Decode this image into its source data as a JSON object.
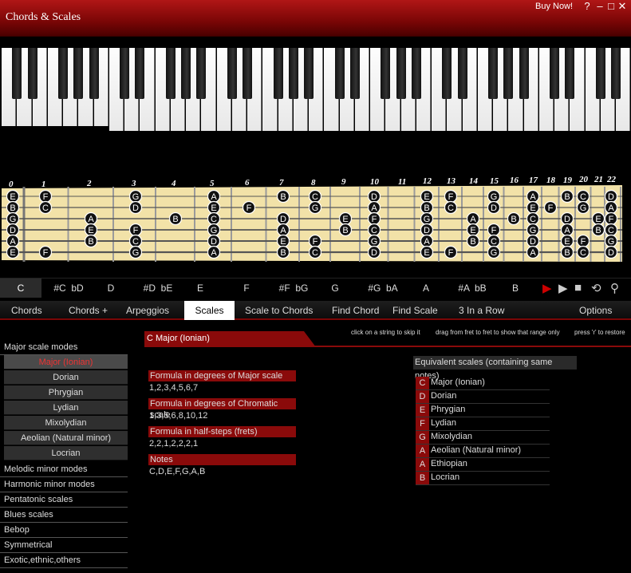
{
  "window": {
    "title": "Chords & Scales",
    "buy_now": "Buy Now!",
    "help": "?",
    "minimize": "–",
    "maximize": "□",
    "close": "✕"
  },
  "fret_numbers": [
    "0",
    "1",
    "2",
    "3",
    "4",
    "5",
    "6",
    "7",
    "8",
    "9",
    "10",
    "11",
    "12",
    "13",
    "14",
    "15",
    "16",
    "17",
    "18",
    "19",
    "20",
    "21",
    "22"
  ],
  "fretboard_strings": [
    "E",
    "B",
    "G",
    "D",
    "A",
    "E"
  ],
  "fretboard_notes": [
    {
      "string": 0,
      "fret": 0,
      "note": "E"
    },
    {
      "string": 0,
      "fret": 1,
      "note": "F"
    },
    {
      "string": 0,
      "fret": 3,
      "note": "G"
    },
    {
      "string": 0,
      "fret": 5,
      "note": "A"
    },
    {
      "string": 0,
      "fret": 7,
      "note": "B"
    },
    {
      "string": 0,
      "fret": 8,
      "note": "C"
    },
    {
      "string": 0,
      "fret": 10,
      "note": "D"
    },
    {
      "string": 0,
      "fret": 12,
      "note": "E"
    },
    {
      "string": 0,
      "fret": 13,
      "note": "F"
    },
    {
      "string": 0,
      "fret": 15,
      "note": "G"
    },
    {
      "string": 0,
      "fret": 17,
      "note": "A"
    },
    {
      "string": 0,
      "fret": 19,
      "note": "B"
    },
    {
      "string": 0,
      "fret": 20,
      "note": "C"
    },
    {
      "string": 0,
      "fret": 22,
      "note": "D"
    },
    {
      "string": 1,
      "fret": 0,
      "note": "B"
    },
    {
      "string": 1,
      "fret": 1,
      "note": "C"
    },
    {
      "string": 1,
      "fret": 3,
      "note": "D"
    },
    {
      "string": 1,
      "fret": 5,
      "note": "E"
    },
    {
      "string": 1,
      "fret": 6,
      "note": "F"
    },
    {
      "string": 1,
      "fret": 8,
      "note": "G"
    },
    {
      "string": 1,
      "fret": 10,
      "note": "A"
    },
    {
      "string": 1,
      "fret": 12,
      "note": "B"
    },
    {
      "string": 1,
      "fret": 13,
      "note": "C"
    },
    {
      "string": 1,
      "fret": 15,
      "note": "D"
    },
    {
      "string": 1,
      "fret": 17,
      "note": "E"
    },
    {
      "string": 1,
      "fret": 18,
      "note": "F"
    },
    {
      "string": 1,
      "fret": 20,
      "note": "G"
    },
    {
      "string": 1,
      "fret": 22,
      "note": "A"
    },
    {
      "string": 2,
      "fret": 0,
      "note": "G"
    },
    {
      "string": 2,
      "fret": 2,
      "note": "A"
    },
    {
      "string": 2,
      "fret": 4,
      "note": "B"
    },
    {
      "string": 2,
      "fret": 5,
      "note": "C"
    },
    {
      "string": 2,
      "fret": 7,
      "note": "D"
    },
    {
      "string": 2,
      "fret": 9,
      "note": "E"
    },
    {
      "string": 2,
      "fret": 10,
      "note": "F"
    },
    {
      "string": 2,
      "fret": 12,
      "note": "G"
    },
    {
      "string": 2,
      "fret": 14,
      "note": "A"
    },
    {
      "string": 2,
      "fret": 16,
      "note": "B"
    },
    {
      "string": 2,
      "fret": 17,
      "note": "C"
    },
    {
      "string": 2,
      "fret": 19,
      "note": "D"
    },
    {
      "string": 2,
      "fret": 21,
      "note": "E"
    },
    {
      "string": 2,
      "fret": 22,
      "note": "F"
    },
    {
      "string": 3,
      "fret": 0,
      "note": "D"
    },
    {
      "string": 3,
      "fret": 2,
      "note": "E"
    },
    {
      "string": 3,
      "fret": 3,
      "note": "F"
    },
    {
      "string": 3,
      "fret": 5,
      "note": "G"
    },
    {
      "string": 3,
      "fret": 7,
      "note": "A"
    },
    {
      "string": 3,
      "fret": 9,
      "note": "B"
    },
    {
      "string": 3,
      "fret": 10,
      "note": "C"
    },
    {
      "string": 3,
      "fret": 12,
      "note": "D"
    },
    {
      "string": 3,
      "fret": 14,
      "note": "E"
    },
    {
      "string": 3,
      "fret": 15,
      "note": "F"
    },
    {
      "string": 3,
      "fret": 17,
      "note": "G"
    },
    {
      "string": 3,
      "fret": 19,
      "note": "A"
    },
    {
      "string": 3,
      "fret": 21,
      "note": "B"
    },
    {
      "string": 3,
      "fret": 22,
      "note": "C"
    },
    {
      "string": 4,
      "fret": 0,
      "note": "A"
    },
    {
      "string": 4,
      "fret": 2,
      "note": "B"
    },
    {
      "string": 4,
      "fret": 3,
      "note": "C"
    },
    {
      "string": 4,
      "fret": 5,
      "note": "D"
    },
    {
      "string": 4,
      "fret": 7,
      "note": "E"
    },
    {
      "string": 4,
      "fret": 8,
      "note": "F"
    },
    {
      "string": 4,
      "fret": 10,
      "note": "G"
    },
    {
      "string": 4,
      "fret": 12,
      "note": "A"
    },
    {
      "string": 4,
      "fret": 14,
      "note": "B"
    },
    {
      "string": 4,
      "fret": 15,
      "note": "C"
    },
    {
      "string": 4,
      "fret": 17,
      "note": "D"
    },
    {
      "string": 4,
      "fret": 19,
      "note": "E"
    },
    {
      "string": 4,
      "fret": 20,
      "note": "F"
    },
    {
      "string": 4,
      "fret": 22,
      "note": "G"
    },
    {
      "string": 5,
      "fret": 0,
      "note": "E"
    },
    {
      "string": 5,
      "fret": 1,
      "note": "F"
    },
    {
      "string": 5,
      "fret": 3,
      "note": "G"
    },
    {
      "string": 5,
      "fret": 5,
      "note": "A"
    },
    {
      "string": 5,
      "fret": 7,
      "note": "B"
    },
    {
      "string": 5,
      "fret": 8,
      "note": "C"
    },
    {
      "string": 5,
      "fret": 10,
      "note": "D"
    },
    {
      "string": 5,
      "fret": 12,
      "note": "E"
    },
    {
      "string": 5,
      "fret": 13,
      "note": "F"
    },
    {
      "string": 5,
      "fret": 15,
      "note": "G"
    },
    {
      "string": 5,
      "fret": 17,
      "note": "A"
    },
    {
      "string": 5,
      "fret": 19,
      "note": "B"
    },
    {
      "string": 5,
      "fret": 20,
      "note": "C"
    },
    {
      "string": 5,
      "fret": 22,
      "note": "D"
    }
  ],
  "keys": [
    "C",
    "#C  bD",
    "D",
    "#D  bE",
    "E",
    "F",
    "#F  bG",
    "G",
    "#G  bA",
    "A",
    "#A  bB",
    "B"
  ],
  "active_key": 0,
  "tabs": [
    "Chords",
    "Chords +",
    "Arpeggios",
    "Scales",
    "Scale to Chords",
    "Find Chord",
    "Find Scale",
    "3 In a Row",
    "Options"
  ],
  "active_tab": 3,
  "categories": {
    "major": "Major scale modes",
    "rest": [
      "Melodic minor modes",
      "Harmonic minor modes",
      "Pentatonic scales",
      "Blues scales",
      "Bebop",
      "Symmetrical",
      "Exotic,ethnic,others"
    ]
  },
  "modes": [
    "Major (Ionian)",
    "Dorian",
    "Phrygian",
    "Lydian",
    "Mixolydian",
    "Aeolian (Natural minor)",
    "Locrian"
  ],
  "active_mode": 0,
  "hints": {
    "skip": "click on a string to skip it",
    "drag": "drag from fret to fret to show that range only",
    "restore": "press 'r' to restore"
  },
  "scale_name": "C Major (Ionian)",
  "formulas": [
    {
      "label": "Formula in degrees of Major scale",
      "value": "1,2,3,4,5,6,7"
    },
    {
      "label": "Formula in degrees of Chromatic scale",
      "value": "1,3,5,6,8,10,12"
    },
    {
      "label": "Formula in  half-steps (frets)",
      "value": "2,2,1,2,2,2,1"
    },
    {
      "label": "Notes",
      "value": "C,D,E,F,G,A,B"
    }
  ],
  "equivalent_title": "Equivalent scales  (containing same notes)",
  "equivalent": [
    {
      "note": "C",
      "name": "Major (Ionian)"
    },
    {
      "note": "D",
      "name": "Dorian"
    },
    {
      "note": "E",
      "name": "Phrygian"
    },
    {
      "note": "F",
      "name": "Lydian"
    },
    {
      "note": "G",
      "name": "Mixolydian"
    },
    {
      "note": "A",
      "name": "Aeolian (Natural minor)"
    },
    {
      "note": "A",
      "name": "Ethiopian"
    },
    {
      "note": "B",
      "name": "Locrian"
    }
  ],
  "colors": {
    "accent": "#8a0a0a",
    "title_bar": "#a01010",
    "wood": "#f2e2a8"
  }
}
